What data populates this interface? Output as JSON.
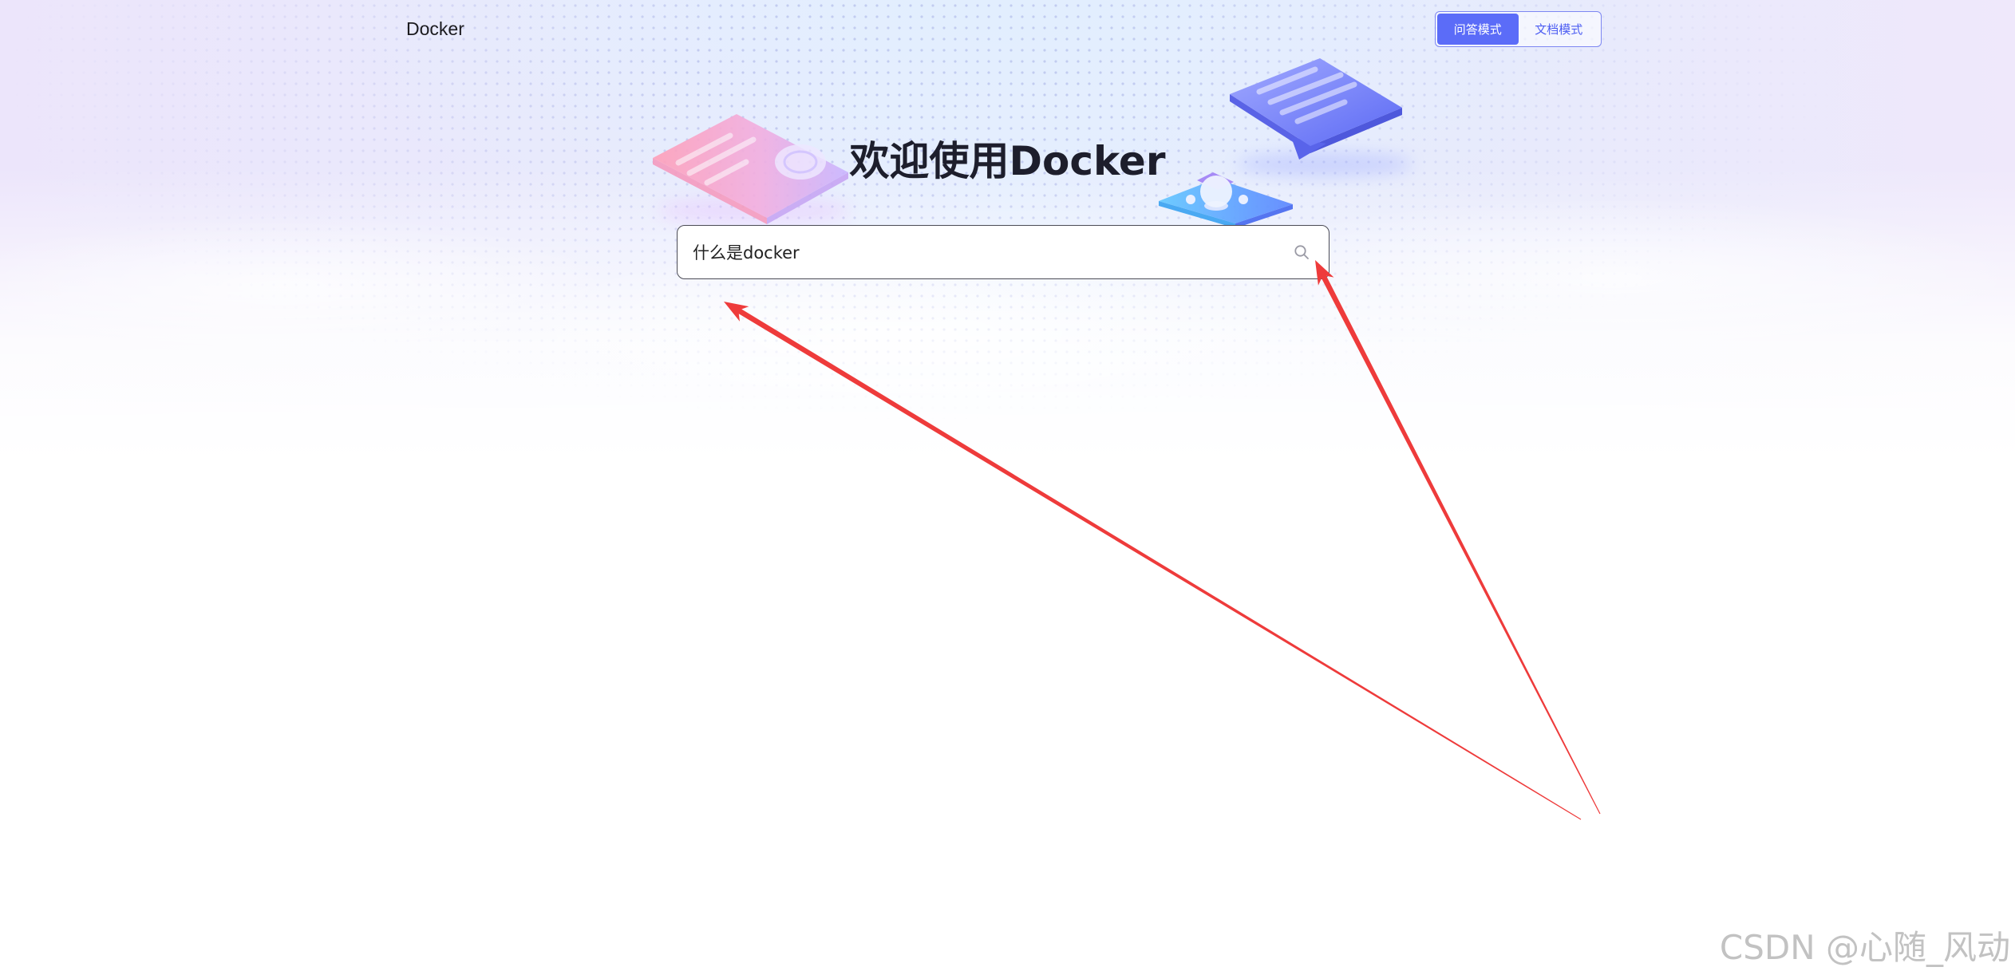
{
  "header": {
    "logo_text": "Docker"
  },
  "mode_toggle": {
    "options": [
      {
        "label": "问答模式",
        "active": true
      },
      {
        "label": "文档模式",
        "active": false
      }
    ]
  },
  "hero": {
    "title": "欢迎使用Docker",
    "illustrations": [
      "document-card-icon",
      "chat-bubble-icon",
      "lightbulb-icon"
    ]
  },
  "search": {
    "value": "什么是docker",
    "icon": "search-icon"
  },
  "watermark": {
    "text": "CSDN @心随_风动"
  },
  "colors": {
    "accent": "#5b6cf8",
    "title": "#1d1e2c",
    "annotation_arrow": "#ee3b3b",
    "watermark": "#c2c2c2"
  }
}
